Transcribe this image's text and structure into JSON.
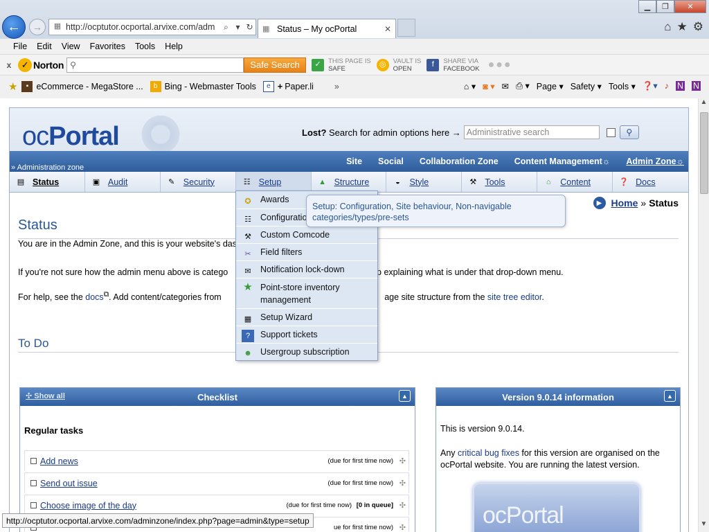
{
  "browser": {
    "address_url": "http://ocptutor.ocportal.arvixe.com/adm",
    "tab_title": "Status – My ocPortal",
    "menu": [
      "File",
      "Edit",
      "View",
      "Favorites",
      "Tools",
      "Help"
    ],
    "norton": {
      "close": "x",
      "logo": "Norton",
      "search_placeholder": "",
      "safe_search": "Safe Search",
      "page_status_top": "THIS PAGE IS",
      "page_status_bottom": "SAFE",
      "vault_top": "VAULT IS",
      "vault_bottom": "OPEN",
      "share_top": "SHARE VIA",
      "share_bottom": "FACEBOOK"
    },
    "favorites": [
      "eCommerce - MegaStore ...",
      "Bing - Webmaster Tools",
      "Paper.li"
    ],
    "commands": [
      "Page",
      "Safety",
      "Tools"
    ],
    "status_url": "http://ocptutor.ocportal.arvixe.com/adminzone/index.php?page=admin&type=setup"
  },
  "site": {
    "logo_oc": "oc",
    "logo_portal": "Portal",
    "search_lost": "Lost?",
    "search_text": "Search for admin options here →",
    "search_placeholder": "Administrative search",
    "zone_label": "» Administration zone",
    "zones": [
      "Site",
      "Social",
      "Collaboration Zone",
      "Content Management",
      "Admin Zone"
    ],
    "admin_tabs": [
      {
        "label": "Status",
        "icon": "status-icon"
      },
      {
        "label": "Audit",
        "icon": "audit-icon"
      },
      {
        "label": "Security",
        "icon": "security-icon"
      },
      {
        "label": "Setup",
        "icon": "setup-icon"
      },
      {
        "label": "Structure",
        "icon": "structure-icon"
      },
      {
        "label": "Style",
        "icon": "style-icon"
      },
      {
        "label": "Tools",
        "icon": "tools-icon"
      },
      {
        "label": "Content",
        "icon": "content-icon"
      },
      {
        "label": "Docs",
        "icon": "docs-icon"
      }
    ],
    "breadcrumb_home": "Home",
    "breadcrumb_sep": "»",
    "breadcrumb_current": "Status",
    "title": "Status",
    "intro1": "You are in the Admin Zone, and this is your website's dash",
    "intro2_a": "If you're not sure how the admin menu above is catego",
    "intro2_b": "ip explaining what is under that drop-down menu.",
    "intro3_a": "For help, see the ",
    "intro3_docs": "docs",
    "intro3_b": ". Add content/categories from ",
    "intro3_c": "age site structure from the ",
    "intro3_link": "site tree editor",
    "intro3_end": ".",
    "todo_heading": "To Do",
    "checklist": {
      "title": "Checklist",
      "show_all": "Show all",
      "section": "Regular tasks",
      "tasks": [
        {
          "label": "Add news",
          "due": "(due for first time now)"
        },
        {
          "label": "Send out issue",
          "due": "(due for first time now)"
        },
        {
          "label": "Choose image of the day",
          "due": "(due for first time now)",
          "queue": "[0 in queue]"
        },
        {
          "label": "",
          "due": "ue for first time now)"
        }
      ]
    },
    "version_box": {
      "title": "Version 9.0.14 information",
      "line1": "This is version 9.0.14.",
      "line2_a": "Any ",
      "line2_link": "critical bug fixes",
      "line2_b": " for this version are organised on the ocPortal website. You are running the latest version.",
      "logo_text": "ocPortal"
    },
    "setup_menu": [
      {
        "label": "Awards",
        "icon": "award-icon"
      },
      {
        "label": "Configuratio",
        "icon": "configuration-icon"
      },
      {
        "label": "Custom Comcode",
        "icon": "comcode-icon"
      },
      {
        "label": "Field filters",
        "icon": "field-filter-icon"
      },
      {
        "label": "Notification lock-down",
        "icon": "notification-icon"
      },
      {
        "label": "Point-store inventory management",
        "icon": "star-icon"
      },
      {
        "label": "Setup Wizard",
        "icon": "wizard-icon"
      },
      {
        "label": "Support tickets",
        "icon": "ticket-icon"
      },
      {
        "label": "Usergroup subscription",
        "icon": "usergroup-icon"
      }
    ],
    "tooltip": "Setup: Configuration, Site behaviour, Non-navigable categories/types/pre-sets"
  }
}
